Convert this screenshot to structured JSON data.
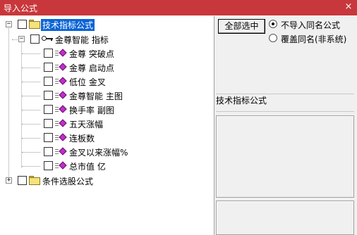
{
  "window": {
    "title": "导入公式",
    "close_glyph": "×"
  },
  "tree": {
    "root": {
      "label": "技术指标公式",
      "expander": "−"
    },
    "group": {
      "label": "金尊智能 指标",
      "expander": "−"
    },
    "items": [
      {
        "label": "金尊 突破点"
      },
      {
        "label": "金尊 启动点"
      },
      {
        "label": "低位 金叉"
      },
      {
        "label": "金尊智能 主图"
      },
      {
        "label": "换手率 副图"
      },
      {
        "label": "五天涨幅"
      },
      {
        "label": "连板数"
      },
      {
        "label": "金叉以来涨幅%"
      },
      {
        "label": "总市值 亿"
      }
    ],
    "second_root": {
      "label": "条件选股公式",
      "expander": "+"
    }
  },
  "right_panel": {
    "select_all_label": "全部选中",
    "options": [
      {
        "label": "不导入同名公式",
        "checked": true
      },
      {
        "label": "覆盖同名(非系统)",
        "checked": false
      }
    ],
    "info_title": "技术指标公式"
  },
  "colors": {
    "titlebar": "#c8373b",
    "selection": "#0a64d6",
    "item_icon": "#c02fc8"
  }
}
